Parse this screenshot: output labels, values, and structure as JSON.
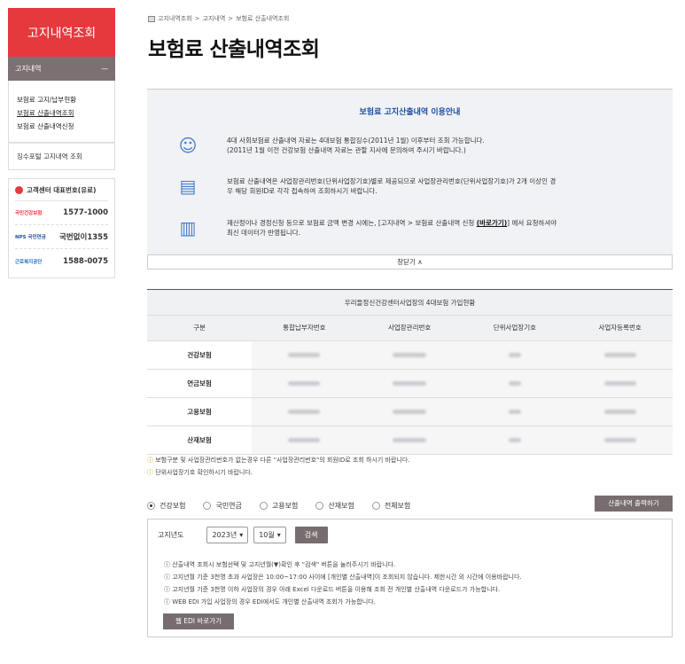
{
  "sidebar": {
    "title": "고지내역조회",
    "section": "고지내역",
    "section_toggle": "—",
    "menu": [
      "보험료 고지/납부현황",
      "보험료 산출내역조회",
      "보험료 산출내역신청"
    ],
    "link": "징수포털 고지내역 조회",
    "callcenter": {
      "title": "고객센터 대표번호(유료)",
      "rows": [
        {
          "logo": "국민건강보험",
          "number": "1577-1000"
        },
        {
          "logo": "NPS 국민연금",
          "number": "국번없이1355"
        },
        {
          "logo": "근로복지공단",
          "number": "1588-0075"
        }
      ]
    }
  },
  "breadcrumb": [
    "고지내역조회",
    "고지내역",
    "보험료 산출내역조회"
  ],
  "page_title": "보험료 산출내역조회",
  "guide": {
    "title": "보험료 고지산출내역 이용안내",
    "items": [
      {
        "l1": "4대 사회보험료 산출내역 자료는 4대보험 통합징수(2011년 1월) 이후부터 조회 가능합니다.",
        "l2": "(2011년 1월 이전 건강보험 산출내역 자료는 관할 지사에 문의하여 주시기 바랍니다.)"
      },
      {
        "l1": "보험료 산출내역은 사업장관리번호(단위사업장기호)별로 제공되므로 사업장관리번호(단위사업장기호)가 2개 이상인 경",
        "l2": "우 해당 회원ID로 각각 접속하여 조회하시기 바랍니다."
      },
      {
        "l1a": "재산정이나 경정신청 등으로 보험료 금액 변경 시에는, [고지내역 > 보험료 산출내역 신청 ",
        "link": "(바로가기)",
        "l1b": "] 에서 요청하셔야",
        "l2": "최신 데이터가 반영됩니다."
      }
    ],
    "close": "창닫기 ∧"
  },
  "table": {
    "caption": "우리들정신건강센터사업장의 4대보험 가입현황",
    "headers": [
      "구분",
      "통합납부자번호",
      "사업장관리번호",
      "단위사업장기호",
      "사업자등록번호"
    ],
    "rows": [
      "건강보험",
      "연금보험",
      "고용보험",
      "산재보험"
    ]
  },
  "notes": [
    "보험구분 및 사업장관리번호가 없는경우 다른 \"사업장관리번호\"의 회원ID로 조회 하시기 바랍니다.",
    "단위사업장기호 확인하시기 바랍니다."
  ],
  "radios": {
    "options": [
      "건강보험",
      "국민연금",
      "고용보험",
      "산재보험",
      "전체보험"
    ],
    "selected": 0
  },
  "print_button": "산출내역 출력하기",
  "search": {
    "label": "고지년도",
    "year": "2023년",
    "month": "10월",
    "button": "검색",
    "notes": [
      "산출내역 조회시 보험선택 및 고지년월(▼)확인 후 \"검색\" 버튼을 눌러주시기 바랍니다.",
      "고지년월 기준 3천명 초과 사업장은 10:00~17:00 사이에 [개인별 산출내역]이 조회되지 않습니다. 제한시간 외 시간에 이용바랍니다.",
      "고지년월 기준 3천명 이하 사업장의 경우 아래 Excel 다운로드 버튼을 이용해 조회 전 개인별 산출내역 다운로드가 가능합니다.",
      "WEB EDI 가입 사업장의 경우 EDI에서도 개인별 산출내역 조회가 가능합니다."
    ],
    "webedi": "웹 EDI 바로가기"
  },
  "colors": {
    "brand": "#e5393d",
    "gray_btn": "#776d6f",
    "guide_bg": "#f0f2f5",
    "guide_title": "#1f4ea1"
  }
}
